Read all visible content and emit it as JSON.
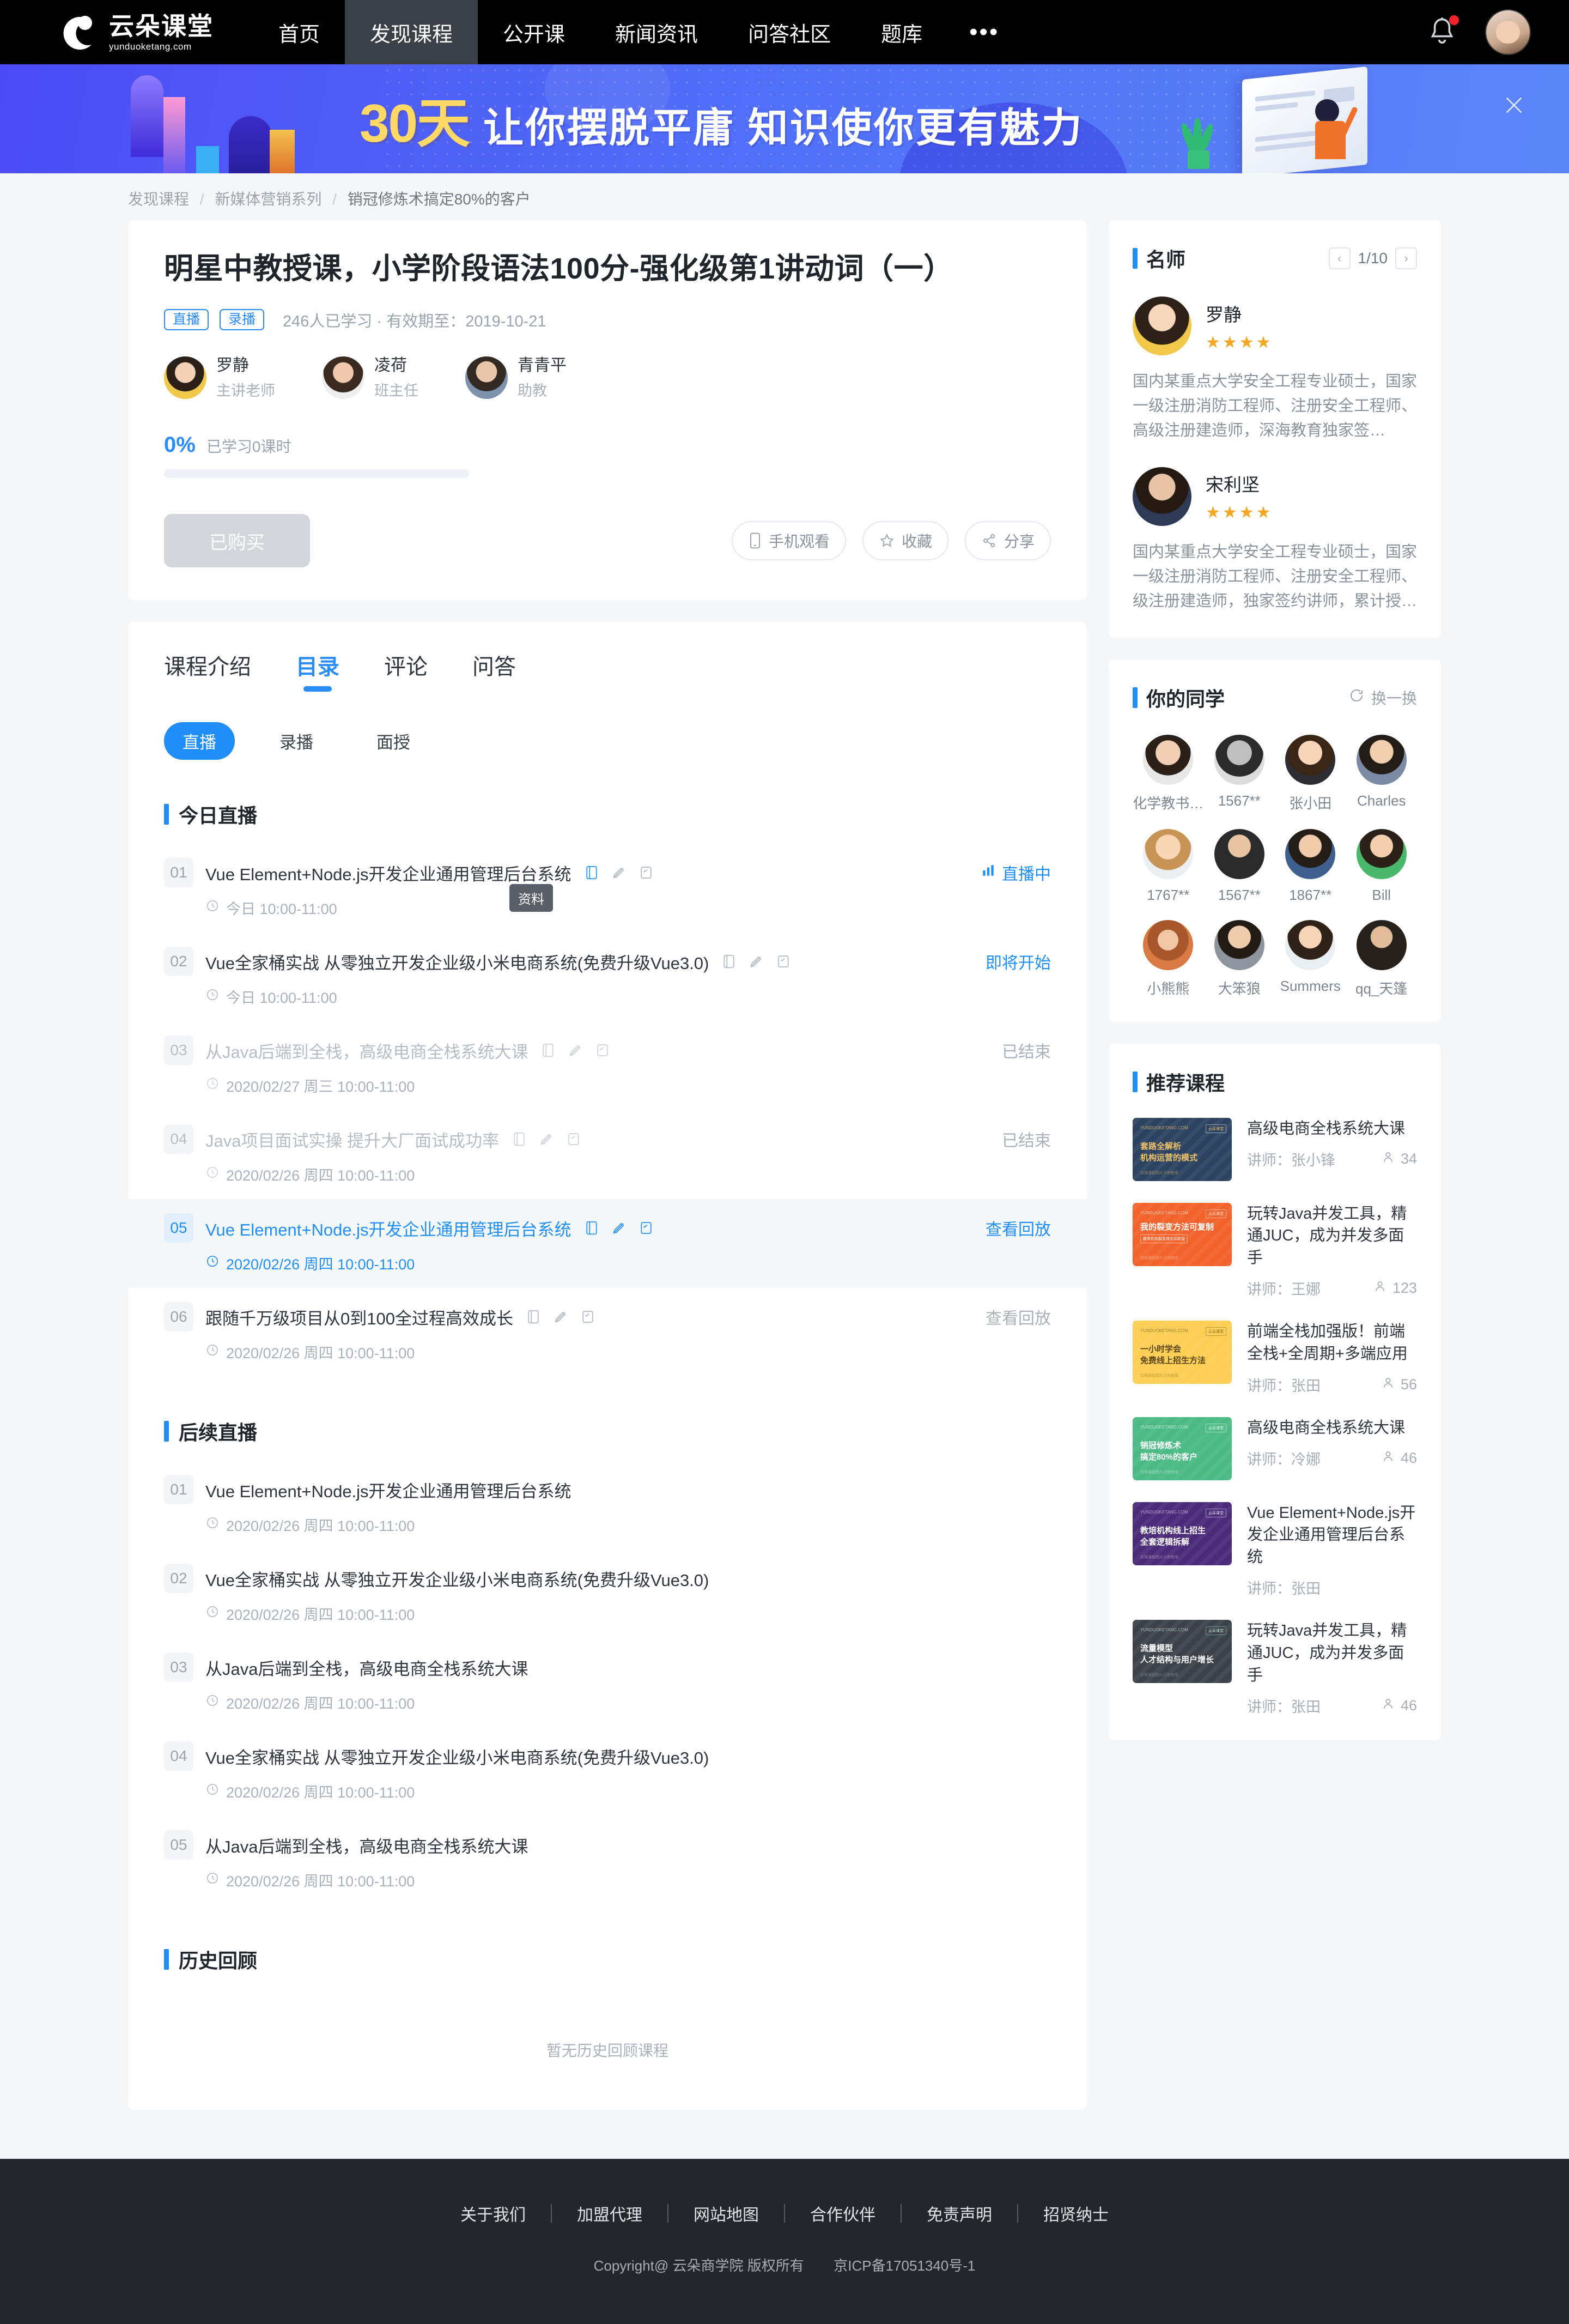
{
  "header": {
    "logo_cn": "云朵课堂",
    "logo_en": "yunduoketang.com",
    "nav": [
      {
        "label": "首页",
        "active": false
      },
      {
        "label": "发现课程",
        "active": true
      },
      {
        "label": "公开课",
        "active": false
      },
      {
        "label": "新闻资讯",
        "active": false
      },
      {
        "label": "问答社区",
        "active": false
      },
      {
        "label": "题库",
        "active": false
      },
      {
        "label": "•••",
        "active": false
      }
    ]
  },
  "banner": {
    "highlight": "30天",
    "text": "让你摆脱平庸 知识使你更有魅力"
  },
  "breadcrumb": {
    "level1": "发现课程",
    "level2": "新媒体营销系列",
    "level3": "销冠修炼术搞定80%的客户"
  },
  "course": {
    "title": "明星中教授课，小学阶段语法100分-强化级第1讲动词（一）",
    "tags": [
      "直播",
      "录播"
    ],
    "meta": "246人已学习 · 有效期至：2019-10-21",
    "teachers": [
      {
        "name": "罗静",
        "role": "主讲老师"
      },
      {
        "name": "凌荷",
        "role": "班主任"
      },
      {
        "name": "青青平",
        "role": "助教"
      }
    ],
    "progress_pct": "0%",
    "progress_text": "已学习0课时",
    "progress_value": 0,
    "buy_button": "已购买",
    "aux_buttons": [
      {
        "label": "手机观看",
        "icon": "mobile-icon"
      },
      {
        "label": "收藏",
        "icon": "star-icon"
      },
      {
        "label": "分享",
        "icon": "share-icon"
      }
    ]
  },
  "tabs": [
    {
      "label": "课程介绍",
      "active": false
    },
    {
      "label": "目录",
      "active": true
    },
    {
      "label": "评论",
      "active": false
    },
    {
      "label": "问答",
      "active": false
    }
  ],
  "chips": [
    {
      "label": "直播",
      "active": true
    },
    {
      "label": "录播",
      "active": false
    },
    {
      "label": "面授",
      "active": false
    }
  ],
  "sections": [
    {
      "title": "今日直播",
      "tooltip": "资料",
      "lessons": [
        {
          "idx": "01",
          "name": "Vue Element+Node.js开发企业通用管理后台系统",
          "time": "今日 10:00-11:00",
          "status": "直播中",
          "status_kind": "live",
          "icons": true,
          "state": "normal"
        },
        {
          "idx": "02",
          "name": "Vue全家桶实战 从零独立开发企业级小米电商系统(免费升级Vue3.0)",
          "time": "今日 10:00-11:00",
          "status": "即将开始",
          "status_kind": "soon",
          "icons": true,
          "state": "normal"
        },
        {
          "idx": "03",
          "name": "从Java后端到全栈，高级电商全栈系统大课",
          "time": "2020/02/27 周三 10:00-11:00",
          "status": "已结束",
          "status_kind": "ended",
          "icons": true,
          "state": "dim"
        },
        {
          "idx": "04",
          "name": "Java项目面试实操 提升大厂面试成功率",
          "time": "2020/02/26 周四 10:00-11:00",
          "status": "已结束",
          "status_kind": "ended",
          "icons": true,
          "state": "dim"
        },
        {
          "idx": "05",
          "name": "Vue Element+Node.js开发企业通用管理后台系统",
          "time": "2020/02/26 周四 10:00-11:00",
          "status": "查看回放",
          "status_kind": "replay",
          "icons": true,
          "state": "highlight"
        },
        {
          "idx": "06",
          "name": "跟随千万级项目从0到100全过程高效成长",
          "time": "2020/02/26 周四 10:00-11:00",
          "status": "查看回放",
          "status_kind": "replay",
          "icons": true,
          "state": "normal"
        }
      ]
    },
    {
      "title": "后续直播",
      "lessons": [
        {
          "idx": "01",
          "name": "Vue Element+Node.js开发企业通用管理后台系统",
          "time": "2020/02/26 周四 10:00-11:00",
          "status": "",
          "status_kind": "none",
          "icons": false,
          "state": "normal"
        },
        {
          "idx": "02",
          "name": "Vue全家桶实战 从零独立开发企业级小米电商系统(免费升级Vue3.0)",
          "time": "2020/02/26 周四 10:00-11:00",
          "status": "",
          "status_kind": "none",
          "icons": false,
          "state": "normal"
        },
        {
          "idx": "03",
          "name": "从Java后端到全栈，高级电商全栈系统大课",
          "time": "2020/02/26 周四 10:00-11:00",
          "status": "",
          "status_kind": "none",
          "icons": false,
          "state": "normal"
        },
        {
          "idx": "04",
          "name": "Vue全家桶实战 从零独立开发企业级小米电商系统(免费升级Vue3.0)",
          "time": "2020/02/26 周四 10:00-11:00",
          "status": "",
          "status_kind": "none",
          "icons": false,
          "state": "normal"
        },
        {
          "idx": "05",
          "name": "从Java后端到全栈，高级电商全栈系统大课",
          "time": "2020/02/26 周四 10:00-11:00",
          "status": "",
          "status_kind": "none",
          "icons": false,
          "state": "normal"
        }
      ]
    },
    {
      "title": "历史回顾",
      "lessons": [],
      "empty": "暂无历史回顾课程"
    }
  ],
  "sidebar": {
    "lecturers_panel": {
      "title": "名师",
      "page": "1/10",
      "prev": "‹",
      "next": "›",
      "items": [
        {
          "name": "罗静",
          "stars": 4,
          "desc": "国内某重点大学安全工程专业硕士，国家一级注册消防工程师、注册安全工程师、高级注册建造师，深海教育独家签…",
          "avatar_tone": "#f3d37a"
        },
        {
          "name": "宋利坚",
          "stars": 4,
          "desc": "国内某重点大学安全工程专业硕士，国家一级注册消防工程师、注册安全工程师、级注册建造师，独家签约讲师，累计授…",
          "avatar_tone": "#2e3a55"
        }
      ]
    },
    "classmates_panel": {
      "title": "你的同学",
      "refresh_label": "换一换",
      "items": [
        {
          "name": "化学教书…",
          "tone": "#e8c7b0"
        },
        {
          "name": "1567**",
          "tone": "#9aa0a8"
        },
        {
          "name": "张小田",
          "tone": "#e5b896"
        },
        {
          "name": "Charles",
          "tone": "#7b8ba6"
        },
        {
          "name": "1767**",
          "tone": "#e8c59b"
        },
        {
          "name": "1567**",
          "tone": "#3b3f46"
        },
        {
          "name": "1867**",
          "tone": "#3f5f8e"
        },
        {
          "name": "Bill",
          "tone": "#49b86a"
        },
        {
          "name": "小熊熊",
          "tone": "#d97943"
        },
        {
          "name": "大笨狼",
          "tone": "#8d949d"
        },
        {
          "name": "Summers",
          "tone": "#cfd4da"
        },
        {
          "name": "qq_天篷",
          "tone": "#34383d"
        }
      ]
    },
    "recommend_panel": {
      "title": "推荐课程",
      "teacher_prefix": "讲师：",
      "items": [
        {
          "title": "高级电商全栈系统大课",
          "teacher": "张小锋",
          "count": "34",
          "thumb_bg": "#2b4260",
          "thumb_title": "套路全解析\n机构运营的模式",
          "thumb_title_color": "#f0c36a"
        },
        {
          "title": "玩转Java并发工具，精通JUC，成为并发多面手",
          "teacher": "王娜",
          "count": "123",
          "thumb_bg": "#f2622a",
          "thumb_title": "我的裂变方法可复制",
          "thumb_title_color": "#ffffff"
        },
        {
          "title": "前端全栈加强版！前端全栈+全周期+多端应用",
          "teacher": "张田",
          "count": "56",
          "thumb_bg": "#fcce54",
          "thumb_title": "一小时学会\n免费线上招生方法",
          "thumb_title_color": "#5a4418"
        },
        {
          "title": "高级电商全栈系统大课",
          "teacher": "冷娜",
          "count": "46",
          "thumb_bg": "#4bba85",
          "thumb_title": "销冠修炼术\n搞定80%的客户",
          "thumb_title_color": "#ffffff"
        },
        {
          "title": "Vue Element+Node.js开发企业通用管理后台系统",
          "teacher": "张田",
          "count": "",
          "thumb_bg": "#4b2a78",
          "thumb_title": "教培机构线上招生\n全套逻辑拆解",
          "thumb_title_color": "#ffffff"
        },
        {
          "title": "玩转Java并发工具，精通JUC，成为并发多面手",
          "teacher": "张田",
          "count": "46",
          "thumb_bg": "#3d4149",
          "thumb_title": "流量模型\n人才结构与用户增长",
          "thumb_title_color": "#ffffff"
        }
      ]
    }
  },
  "footer": {
    "links": [
      "关于我们",
      "加盟代理",
      "网站地图",
      "合作伙伴",
      "免责声明",
      "招贤纳士"
    ],
    "copyright": "Copyright@ 云朵商学院  版权所有",
    "icp": "京ICP备17051340号-1"
  },
  "colors": {
    "accent": "#1f8ff7",
    "banner_highlight": "#ffd966",
    "star": "#f5a623"
  }
}
